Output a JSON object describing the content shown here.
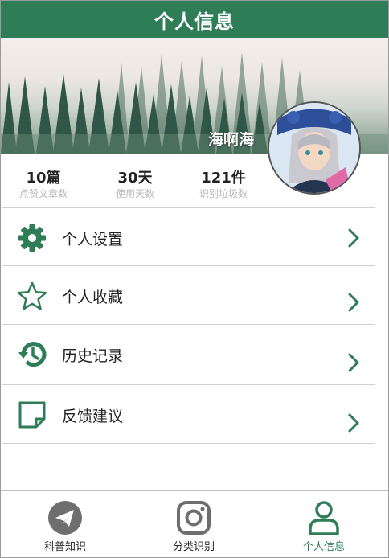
{
  "header": {
    "title": "个人信息"
  },
  "profile": {
    "username": "海啊海"
  },
  "stats": [
    {
      "value": "10篇",
      "label": "点赞文章数"
    },
    {
      "value": "30天",
      "label": "使用天数"
    },
    {
      "value": "121件",
      "label": "识别垃圾数"
    }
  ],
  "menu": [
    {
      "label": "个人设置",
      "icon": "gear-icon"
    },
    {
      "label": "个人收藏",
      "icon": "star-icon"
    },
    {
      "label": "历史记录",
      "icon": "history-icon"
    },
    {
      "label": "反馈建议",
      "icon": "note-icon"
    }
  ],
  "tabs": [
    {
      "label": "科普知识",
      "icon": "paper-plane-icon",
      "active": false
    },
    {
      "label": "分类识别",
      "icon": "camera-icon",
      "active": false
    },
    {
      "label": "个人信息",
      "icon": "user-icon",
      "active": true
    }
  ],
  "colors": {
    "accent": "#2e7d57",
    "muted": "#b9b9b9"
  }
}
